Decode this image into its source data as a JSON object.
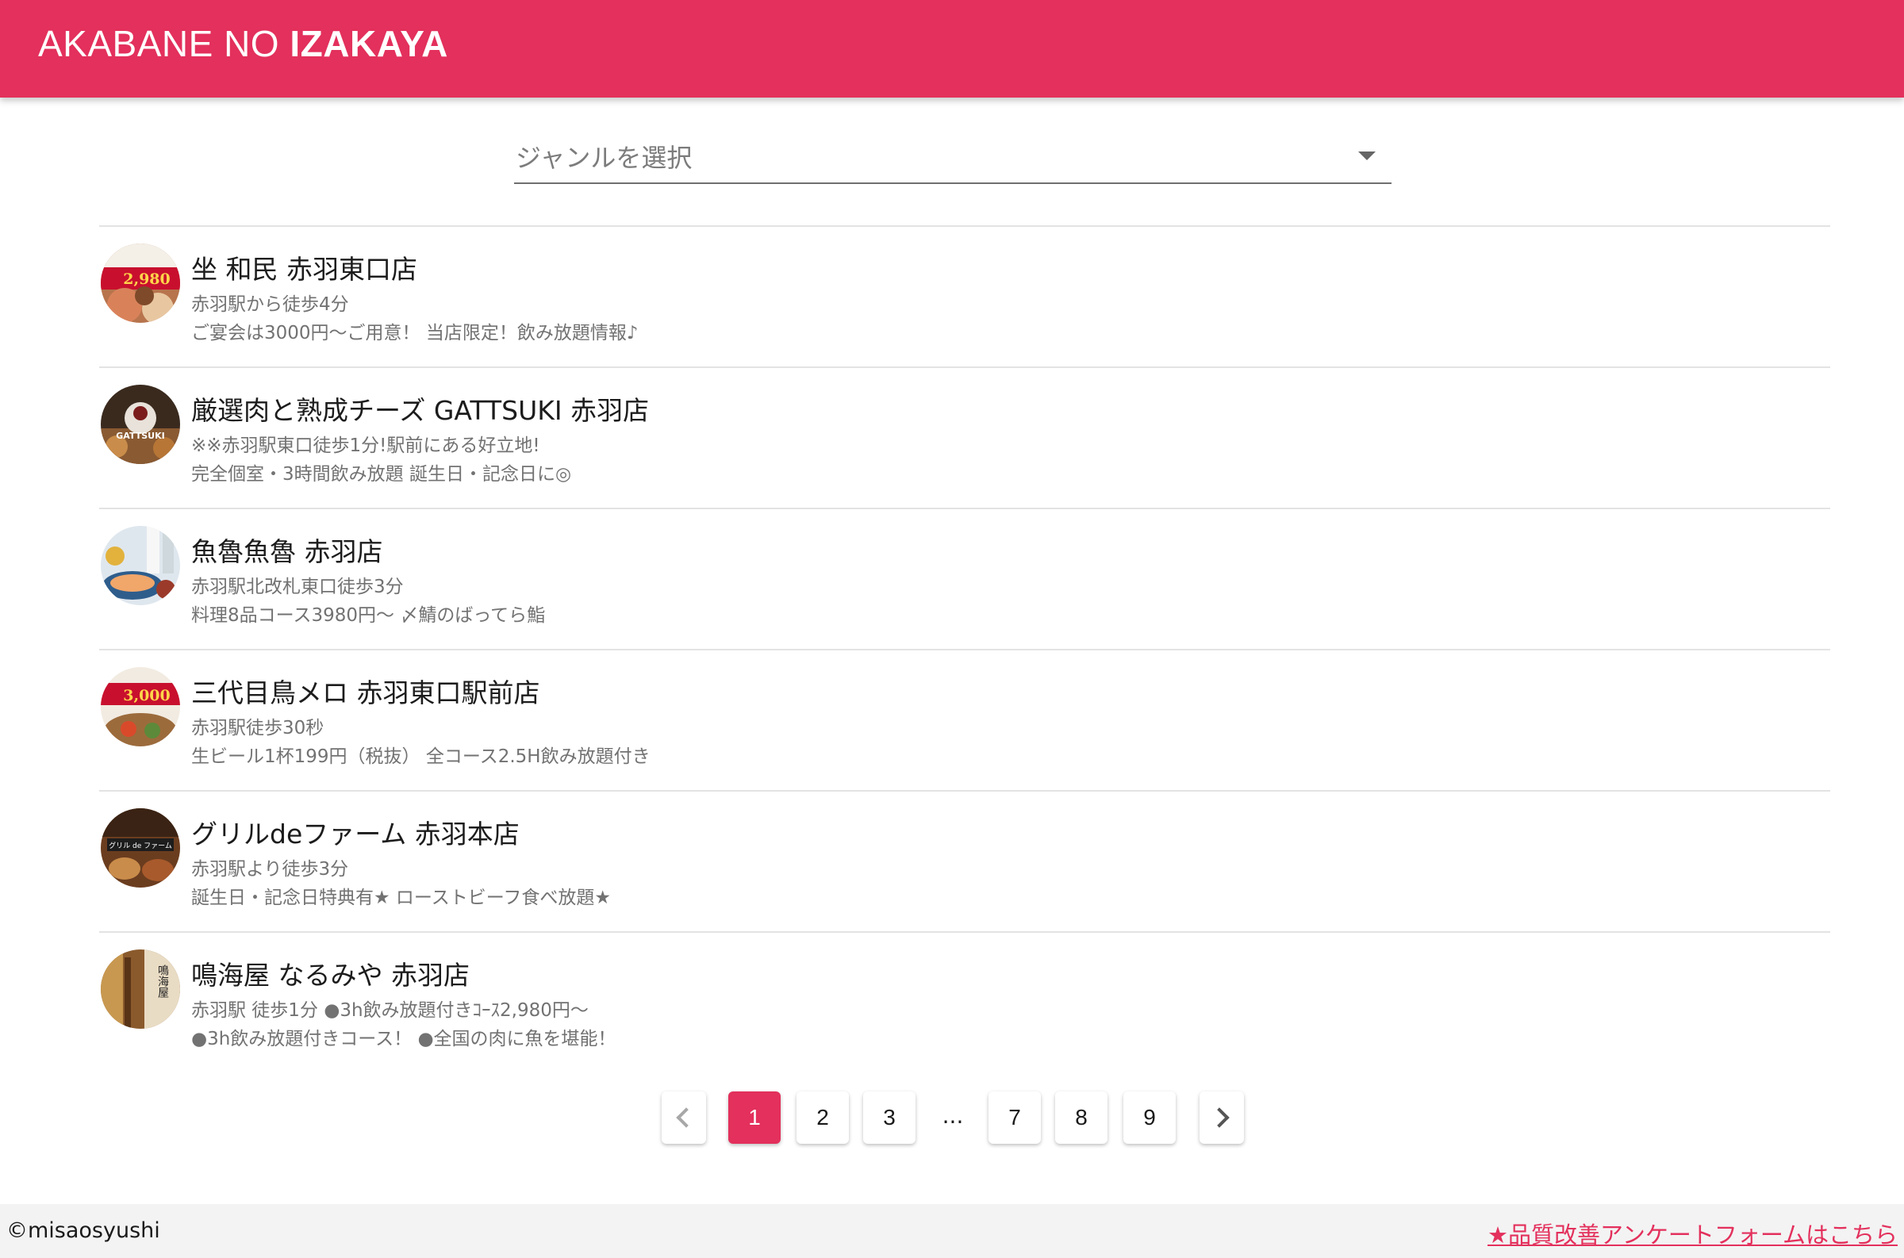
{
  "header": {
    "title_light": "AKABANE NO ",
    "title_bold": "IZAKAYA",
    "color": "#e3305c"
  },
  "genre_select": {
    "placeholder": "ジャンルを選択"
  },
  "restaurants": [
    {
      "name": "坐 和民 赤羽東口店",
      "access": "赤羽駅から徒歩4分",
      "catch": "ご宴会は3000円～ご用意！ 当店限定！飲み放題情報♪",
      "thumb_text": "2,980"
    },
    {
      "name": "厳選肉と熟成チーズ GATTSUKI 赤羽店",
      "access": "※※赤羽駅東口徒歩1分!駅前にある好立地!",
      "catch": "完全個室・3時間飲み放題 誕生日・記念日に◎",
      "thumb_text": "GATTSUKI"
    },
    {
      "name": "魚魯魚魯 赤羽店",
      "access": "赤羽駅北改札東口徒歩3分",
      "catch": "料理8品コース3980円～ 〆鯖のばってら鮨",
      "thumb_text": ""
    },
    {
      "name": "三代目鳥メロ 赤羽東口駅前店",
      "access": "赤羽駅徒歩30秒",
      "catch": "生ビール1杯199円（税抜） 全コース2.5H飲み放題付き",
      "thumb_text": "3,000"
    },
    {
      "name": "グリルdeファーム 赤羽本店",
      "access": "赤羽駅より徒歩3分",
      "catch": "誕生日・記念日特典有★ ローストビーフ食べ放題★",
      "thumb_text": "グリル de ファーム"
    },
    {
      "name": "鳴海屋 なるみや 赤羽店",
      "access": "赤羽駅 徒歩1分 ●3h飲み放題付きｺｰｽ2,980円～",
      "catch": "●3h飲み放題付きコース！ ●全国の肉に魚を堪能！",
      "thumb_text": "鳴海屋"
    }
  ],
  "pagination": {
    "pages_start": [
      "1",
      "2",
      "3"
    ],
    "ellipsis": "...",
    "pages_end": [
      "7",
      "8",
      "9"
    ],
    "current": "1",
    "prev_icon": "chevron-left-icon",
    "next_icon": "chevron-right-icon"
  },
  "footer": {
    "copyright": "©misaosyushi",
    "survey_link": "★品質改善アンケートフォームはこちら"
  }
}
